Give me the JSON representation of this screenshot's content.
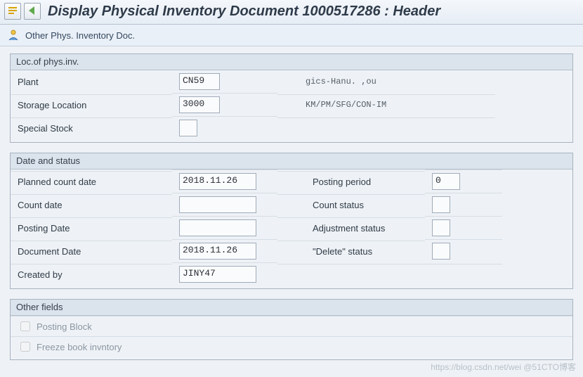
{
  "titlebar": {
    "title": "Display Physical Inventory Document 1000517286 : Header"
  },
  "apptoolbar": {
    "other_doc": "Other Phys. Inventory Doc."
  },
  "loc": {
    "legend": "Loc.of phys.inv.",
    "plant_label": "Plant",
    "plant_value": "CN59",
    "plant_desc": "            gics-Hanu.   ,ou",
    "sloc_label": "Storage Location",
    "sloc_value": "3000",
    "sloc_desc": "KM/PM/SFG/CON-IM",
    "special_label": "Special Stock",
    "special_value": ""
  },
  "date_status": {
    "legend": "Date and status",
    "planned_label": "Planned count date",
    "planned_value": "2018.11.26",
    "count_label": "Count date",
    "count_value": "",
    "posting_label": "Posting Date",
    "posting_value": "",
    "doc_label": "Document Date",
    "doc_value": "2018.11.26",
    "created_label": "Created by",
    "created_value": "JINY47",
    "period_label": "Posting period",
    "period_value": "0",
    "cstat_label": "Count status",
    "cstat_value": "",
    "astat_label": "Adjustment status",
    "astat_value": "",
    "dstat_label": "\"Delete\" status",
    "dstat_value": ""
  },
  "other": {
    "legend": "Other fields",
    "posting_block": "Posting Block",
    "freeze": "Freeze book invntory"
  },
  "watermark": "https://blog.csdn.net/wei @51CTO博客"
}
